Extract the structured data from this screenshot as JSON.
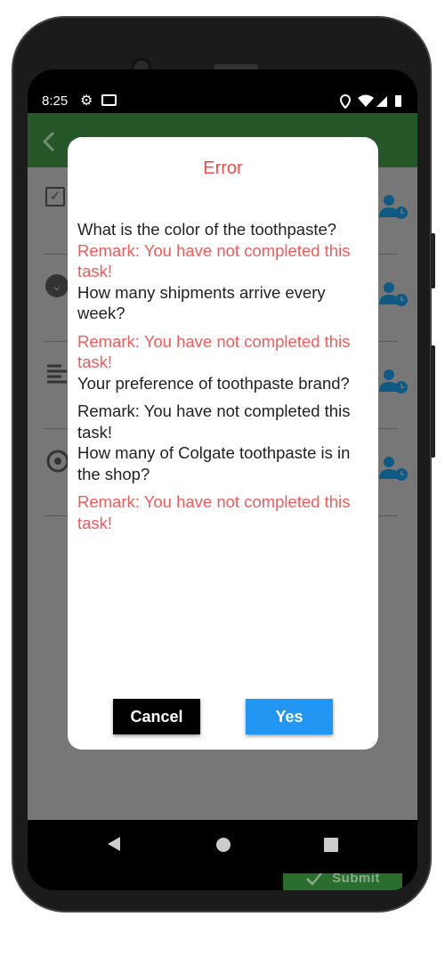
{
  "status_bar": {
    "time": "8:25",
    "icons": [
      "gear-icon",
      "mail-icon",
      "location-icon",
      "wifi-icon",
      "signal-icon",
      "battery-icon"
    ]
  },
  "app_bar": {
    "back_icon": "chevron-left-icon"
  },
  "task_rows": [
    {
      "icon": "checkbox-icon"
    },
    {
      "icon": "dropdown-icon"
    },
    {
      "icon": "text-icon"
    },
    {
      "icon": "radio-icon"
    }
  ],
  "dialog": {
    "title": "Error",
    "items": [
      {
        "question": "What is the color of the toothpaste?",
        "remark": "Remark: You have not completed this task!",
        "remark_color": "#f45a5a"
      },
      {
        "question": "How many shipments arrive every week?",
        "remark": "Remark: You have not completed this task!",
        "remark_color": "#f45a5a"
      },
      {
        "question": "Your preference of toothpaste brand?",
        "remark": "Remark: You have not completed this task!",
        "remark_color": "#222222"
      },
      {
        "question": "How many of Colgate toothpaste is in the shop?",
        "remark": "Remark: You have not completed this task!",
        "remark_color": "#f45a5a"
      }
    ],
    "cancel_label": "Cancel",
    "yes_label": "Yes"
  },
  "submit_label": "Submit",
  "nav": {
    "back": "back-icon",
    "home": "home-icon",
    "recents": "recents-icon"
  }
}
